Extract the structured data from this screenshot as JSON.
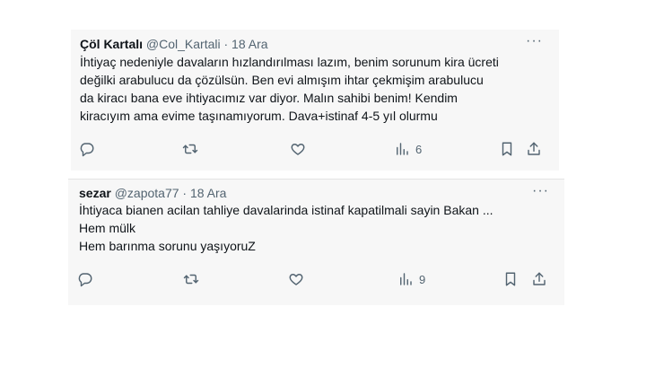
{
  "tweets": [
    {
      "author": "Çöl Kartalı",
      "handle": "@Col_Kartali",
      "separator": "·",
      "date": "18 Ara",
      "more": "···",
      "lines": [
        "İhtiyaç nedeniyle davaların hızlandırılması lazım, benim sorunum kira ücreti",
        "değilki arabulucu da çözülsün. Ben evi almışım ihtar çekmişim arabulucu",
        "da kiracı bana eve ihtiyacımız var diyor. Malın sahibi benim! Kendim",
        "kiracıyım ama evime taşınamıyorum. Dava+istinaf 4-5 yıl olurmu"
      ],
      "view_count": "6"
    },
    {
      "author": "sezar",
      "handle": "@zapota77",
      "separator": "·",
      "date": "18 Ara",
      "more": "···",
      "lines": [
        "İhtiyaca bianen acilan tahliye davalarinda istinaf kapatilmali sayin Bakan ...",
        "Hem mülk",
        "Hem barınma sorunu yaşıyoruZ"
      ],
      "view_count": "9"
    }
  ],
  "icons": [
    "reply-icon",
    "retweet-icon",
    "like-icon",
    "views-icon",
    "bookmark-icon",
    "share-icon"
  ]
}
